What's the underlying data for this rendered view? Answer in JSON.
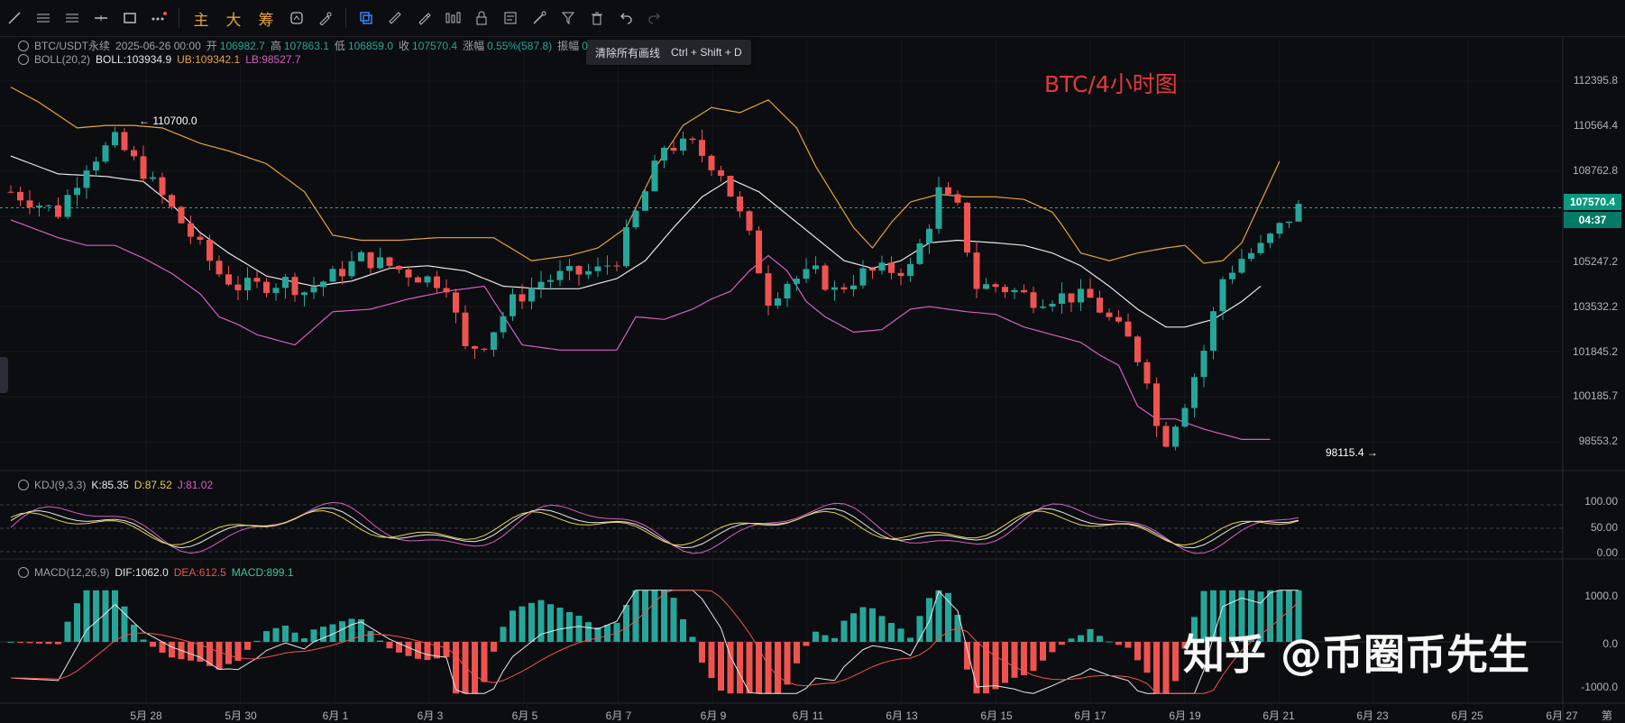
{
  "toolbar": {
    "tools_left": [
      "trend-line-icon",
      "horizontal-lines-icon",
      "parallel-channel-icon",
      "horizontal-ray-icon",
      "rectangle-icon",
      "more-tools-icon"
    ],
    "cjk_tools": [
      "主",
      "大",
      "筹"
    ],
    "tools_right": [
      "measure-icon",
      "eraser-icon",
      "select-icon",
      "ruler-icon",
      "brush-icon",
      "bar-pattern-icon",
      "lock-icon",
      "data-window-icon",
      "magic-icon",
      "filter-icon",
      "delete-icon",
      "undo-icon",
      "redo-icon"
    ],
    "tooltip": {
      "text": "清除所有画线",
      "shortcut": "Ctrl + Shift + D"
    }
  },
  "legend_main": {
    "symbol": "BTC/USDT永续",
    "datetime": "2025-06-26 00:00",
    "open_label": "开",
    "open": "106982.7",
    "high_label": "高",
    "high": "107863.1",
    "low_label": "低",
    "low": "106859.0",
    "close_label": "收",
    "close": "107570.4",
    "change_label": "涨幅",
    "change": "0.55%(587.8)",
    "amp_label": "振幅",
    "amp": "0"
  },
  "legend_boll": {
    "name": "BOLL(20,2)",
    "boll": "BOLL:103934.9",
    "ub": "UB:109342.1",
    "lb": "LB:98527.7"
  },
  "legend_kdj": {
    "name": "KDJ(9,3,3)",
    "k": "K:85.35",
    "d": "D:87.52",
    "j": "J:81.02"
  },
  "legend_macd": {
    "name": "MACD(12,26,9)",
    "dif": "DIF:1062.0",
    "dea": "DEA:612.5",
    "macd": "MACD:899.1"
  },
  "chart_title": "BTC/4小时图",
  "price_axis": [
    "112395.8",
    "110564.4",
    "108762.8",
    "107570.4",
    "105247.2",
    "103532.2",
    "101845.2",
    "100185.7",
    "98553.2"
  ],
  "last_price": {
    "price": "107570.4",
    "countdown": "04:37"
  },
  "kdj_axis": [
    "100.00",
    "50.00",
    "0.00"
  ],
  "macd_axis": [
    "1000.0",
    "0.0",
    "-1000.0"
  ],
  "markers": {
    "high": "← 110700.0",
    "low": "98115.4 →"
  },
  "date_axis": [
    "5月 28",
    "5月 30",
    "6月 1",
    "6月 3",
    "6月 5",
    "6月 7",
    "6月 9",
    "6月 11",
    "6月 13",
    "6月 15",
    "6月 17",
    "6月 19",
    "6月 21",
    "6月 23",
    "6月 25",
    "6月 27",
    "第 "
  ],
  "watermark": "知乎 @币圈币先生",
  "colors": {
    "up": "#26a69a",
    "down": "#ef5350",
    "boll": "#e8e8ea",
    "ub": "#e6a23c",
    "lb": "#d45fc1",
    "k": "#e8e8ea",
    "d": "#e6d34f",
    "j": "#d45fc1",
    "title": "#e03a3a"
  },
  "chart_data": {
    "type": "candlestick",
    "title": "BTC/4小时图",
    "symbol": "BTC/USDT永续",
    "x_ticks": [
      "5月 28",
      "5月 30",
      "6月 1",
      "6月 3",
      "6月 5",
      "6月 7",
      "6月 9",
      "6月 11",
      "6月 13",
      "6月 15",
      "6月 17",
      "6月 19",
      "6月 21",
      "6月 23",
      "6月 25",
      "6月 27"
    ],
    "ylim": [
      97700,
      113100
    ],
    "annotations": [
      {
        "label": "110700.0",
        "value": 110700
      },
      {
        "label": "98115.4",
        "value": 98115.4
      }
    ],
    "close_path": [
      [
        0,
        108200
      ],
      [
        5,
        107400
      ],
      [
        8,
        109300
      ],
      [
        11,
        110200
      ],
      [
        14,
        109000
      ],
      [
        17,
        107500
      ],
      [
        20,
        106000
      ],
      [
        22,
        105000
      ],
      [
        24,
        104500
      ],
      [
        26,
        104500
      ],
      [
        29,
        104700
      ],
      [
        31,
        104300
      ],
      [
        34,
        104900
      ],
      [
        37,
        105600
      ],
      [
        40,
        105300
      ],
      [
        43,
        104900
      ],
      [
        46,
        104600
      ],
      [
        48,
        102000
      ],
      [
        50,
        102300
      ],
      [
        53,
        103900
      ],
      [
        56,
        104700
      ],
      [
        58,
        104900
      ],
      [
        60,
        105000
      ],
      [
        62,
        105100
      ],
      [
        64,
        105600
      ],
      [
        67,
        108200
      ],
      [
        69,
        110000
      ],
      [
        72,
        110000
      ],
      [
        75,
        109000
      ],
      [
        78,
        106400
      ],
      [
        80,
        104000
      ],
      [
        82,
        104700
      ],
      [
        85,
        105000
      ],
      [
        87,
        104300
      ],
      [
        90,
        105000
      ],
      [
        92,
        105100
      ],
      [
        95,
        105200
      ],
      [
        97,
        107000
      ],
      [
        98,
        108200
      ],
      [
        100,
        107500
      ],
      [
        102,
        104500
      ],
      [
        104,
        104500
      ],
      [
        106,
        104300
      ],
      [
        108,
        104000
      ],
      [
        110,
        104100
      ],
      [
        112,
        104100
      ],
      [
        114,
        104000
      ],
      [
        116,
        103200
      ],
      [
        118,
        102400
      ],
      [
        120,
        101000
      ],
      [
        121,
        99000
      ],
      [
        122,
        98500
      ],
      [
        124,
        100000
      ],
      [
        126,
        102000
      ],
      [
        128,
        104800
      ],
      [
        130,
        105600
      ],
      [
        132,
        106000
      ],
      [
        134,
        106800
      ],
      [
        136,
        107570.4
      ]
    ],
    "boll_mid": [
      [
        0,
        109600
      ],
      [
        5,
        108900
      ],
      [
        10,
        108800
      ],
      [
        14,
        108600
      ],
      [
        17,
        107700
      ],
      [
        20,
        106600
      ],
      [
        23,
        105800
      ],
      [
        27,
        104900
      ],
      [
        32,
        104500
      ],
      [
        36,
        104700
      ],
      [
        40,
        105200
      ],
      [
        44,
        105300
      ],
      [
        48,
        105100
      ],
      [
        52,
        104500
      ],
      [
        56,
        104400
      ],
      [
        60,
        104400
      ],
      [
        64,
        104800
      ],
      [
        67,
        105500
      ],
      [
        70,
        106800
      ],
      [
        73,
        108000
      ],
      [
        76,
        108700
      ],
      [
        79,
        108200
      ],
      [
        82,
        107300
      ],
      [
        85,
        106400
      ],
      [
        88,
        105500
      ],
      [
        91,
        105200
      ],
      [
        94,
        105500
      ],
      [
        97,
        106200
      ],
      [
        100,
        106300
      ],
      [
        104,
        106200
      ],
      [
        107,
        106100
      ],
      [
        110,
        105800
      ],
      [
        113,
        105300
      ],
      [
        116,
        104500
      ],
      [
        119,
        103600
      ],
      [
        122,
        102900
      ],
      [
        124,
        102900
      ],
      [
        127,
        103200
      ],
      [
        130,
        103900
      ],
      [
        132,
        104500
      ]
    ],
    "boll_ub": [
      [
        0,
        112300
      ],
      [
        3,
        111700
      ],
      [
        7,
        110700
      ],
      [
        10,
        110800
      ],
      [
        13,
        110800
      ],
      [
        16,
        110700
      ],
      [
        20,
        110100
      ],
      [
        23,
        109800
      ],
      [
        27,
        109300
      ],
      [
        31,
        108200
      ],
      [
        34,
        106500
      ],
      [
        37,
        106300
      ],
      [
        41,
        106300
      ],
      [
        45,
        106400
      ],
      [
        48,
        106400
      ],
      [
        51,
        106400
      ],
      [
        55,
        105500
      ],
      [
        59,
        105700
      ],
      [
        62,
        106000
      ],
      [
        65,
        106800
      ],
      [
        68,
        109100
      ],
      [
        71,
        110800
      ],
      [
        74,
        111500
      ],
      [
        77,
        111300
      ],
      [
        80,
        111800
      ],
      [
        83,
        110700
      ],
      [
        85,
        109200
      ],
      [
        87,
        108000
      ],
      [
        89,
        106800
      ],
      [
        91,
        106000
      ],
      [
        93,
        107000
      ],
      [
        95,
        107800
      ],
      [
        98,
        108100
      ],
      [
        101,
        108000
      ],
      [
        104,
        108000
      ],
      [
        107,
        107900
      ],
      [
        110,
        107400
      ],
      [
        111,
        106900
      ],
      [
        113,
        105800
      ],
      [
        116,
        105500
      ],
      [
        119,
        105800
      ],
      [
        122,
        106000
      ],
      [
        124,
        106100
      ],
      [
        126,
        105400
      ],
      [
        128,
        105500
      ],
      [
        130,
        106200
      ],
      [
        132,
        107800
      ],
      [
        134,
        109400
      ]
    ],
    "boll_lb": [
      [
        0,
        107100
      ],
      [
        5,
        106400
      ],
      [
        8,
        106100
      ],
      [
        11,
        106100
      ],
      [
        14,
        105600
      ],
      [
        17,
        105000
      ],
      [
        20,
        104200
      ],
      [
        22,
        103300
      ],
      [
        24,
        103000
      ],
      [
        26,
        102600
      ],
      [
        30,
        102200
      ],
      [
        34,
        103500
      ],
      [
        38,
        103600
      ],
      [
        42,
        104000
      ],
      [
        46,
        104300
      ],
      [
        50,
        104500
      ],
      [
        54,
        102200
      ],
      [
        58,
        102000
      ],
      [
        61,
        102000
      ],
      [
        64,
        102000
      ],
      [
        66,
        103300
      ],
      [
        69,
        103200
      ],
      [
        72,
        103600
      ],
      [
        74,
        104000
      ],
      [
        76,
        104300
      ],
      [
        78,
        105100
      ],
      [
        80,
        105700
      ],
      [
        82,
        105100
      ],
      [
        84,
        103900
      ],
      [
        86,
        103300
      ],
      [
        89,
        102700
      ],
      [
        92,
        102800
      ],
      [
        95,
        103600
      ],
      [
        97,
        103700
      ],
      [
        101,
        103500
      ],
      [
        104,
        103400
      ],
      [
        107,
        102900
      ],
      [
        110,
        102600
      ],
      [
        113,
        102300
      ],
      [
        115,
        101800
      ],
      [
        117,
        101400
      ],
      [
        119,
        99800
      ],
      [
        121,
        99300
      ],
      [
        123,
        99300
      ],
      [
        126,
        98900
      ],
      [
        130,
        98500
      ],
      [
        133,
        98500
      ]
    ],
    "kdj": {
      "k": "85.35",
      "d": "87.52",
      "j": "81.02",
      "ylim": [
        0,
        100
      ]
    },
    "macd": {
      "dif": "1062.0",
      "dea": "612.5",
      "macd": "899.1",
      "ylim": [
        -1100,
        1100
      ]
    }
  }
}
